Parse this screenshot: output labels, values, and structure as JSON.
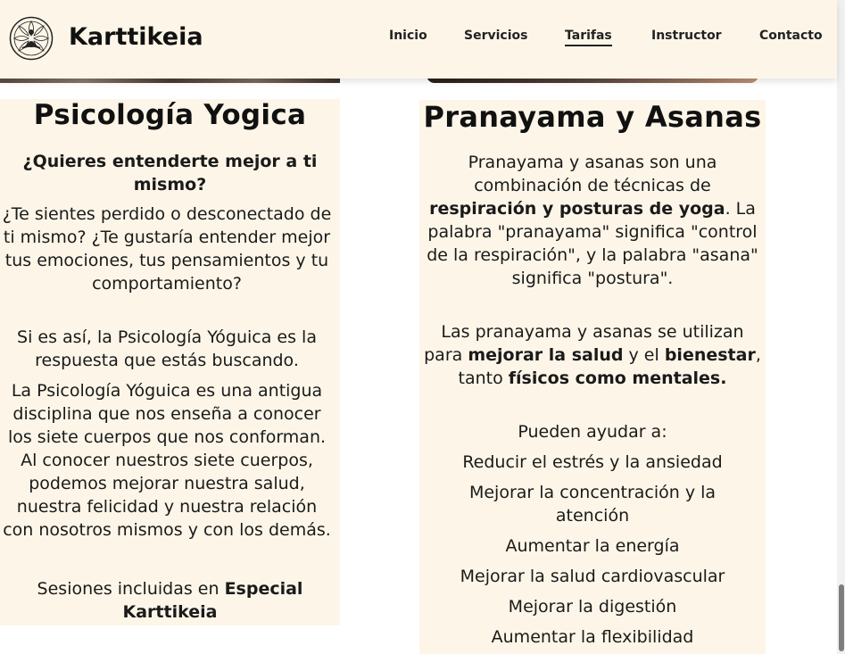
{
  "header": {
    "brand": "Karttikeia",
    "logo_icon": "meditation-lotus-icon",
    "nav": [
      {
        "label": "Inicio"
      },
      {
        "label": "Servicios"
      },
      {
        "label": "Tarifas",
        "active": true
      },
      {
        "label": "Instructor"
      },
      {
        "label": "Contacto"
      }
    ]
  },
  "left_card": {
    "title": "Psicología Yogica",
    "q_line1": "¿Quieres entenderte mejor a ti",
    "q_line2": "mismo?",
    "p1": "¿Te sientes perdido o desconectado de ti mismo? ¿Te gustaría entender mejor tus emociones, tus pensamientos y tu comportamiento?",
    "p2": "Si es así, la Psicología Yóguica es la respuesta que estás buscando.",
    "p3": "La Psicología Yóguica es una antigua disciplina que nos enseña a conocer los siete cuerpos que nos conforman. Al conocer nuestros siete cuerpos, podemos mejorar nuestra salud, nuestra felicidad y nuestra relación con nosotros mismos y con los demás.",
    "sessions_prefix": "Sesiones incluidas en ",
    "sessions_plan_1": "Especial",
    "sessions_plan_2": "Karttikeia"
  },
  "right_card": {
    "title": "Pranayama y Asanas",
    "p1_a": "Pranayama y asanas son una combinación de técnicas de ",
    "p1_b": "respiración y posturas de yoga",
    "p1_c": ". La palabra \"pranayama\" significa \"control de la respiración\", y la palabra \"asana\" significa \"postura\".",
    "p2_a": "Las pranayama y asanas se utilizan para ",
    "p2_b": "mejorar la salud",
    "p2_c": " y el ",
    "p2_d": "bienestar",
    "p2_e": ", tanto ",
    "p2_f": "físicos como mentales.",
    "help_intro": "Pueden ayudar a:",
    "benefit_1": "Reducir el estrés y la ansiedad",
    "benefit_2a": "Mejorar la concentración y la",
    "benefit_2b": "atención",
    "benefit_3": "Aumentar la energía",
    "benefit_4": "Mejorar la salud cardiovascular",
    "benefit_5": "Mejorar la digestión",
    "benefit_6": "Aumentar la flexibilidad"
  },
  "colors": {
    "header_bg": "#fdf6e8",
    "card_bg": "#fdf6e8",
    "text": "#1a1a1a"
  }
}
